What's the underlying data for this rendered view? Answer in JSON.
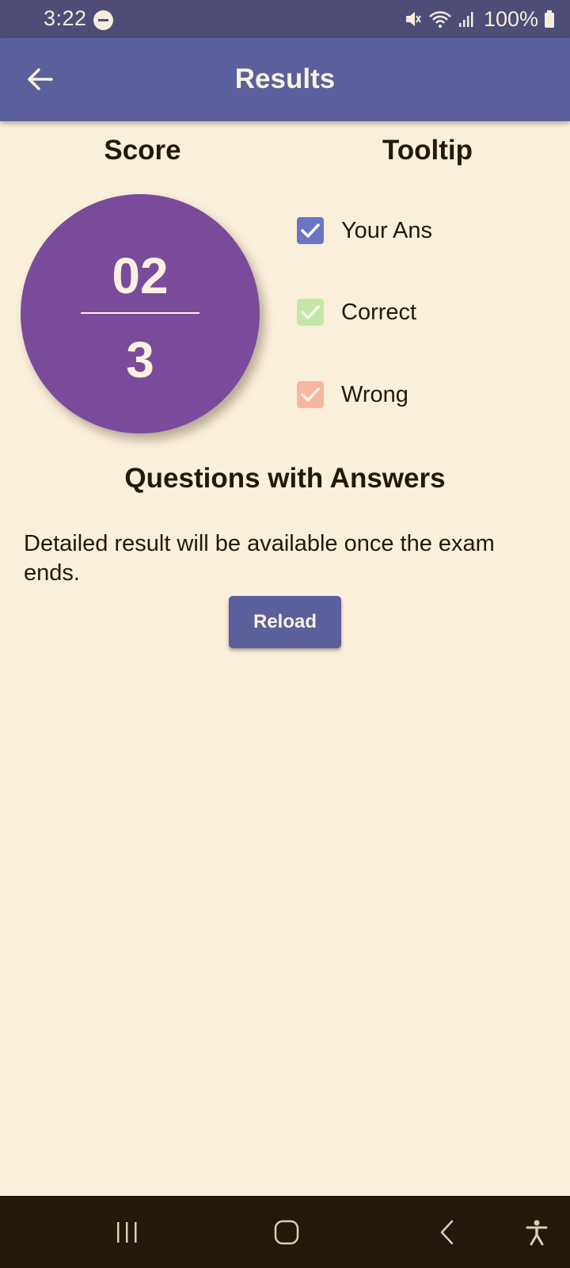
{
  "status_bar": {
    "time": "3:22",
    "battery": "100%",
    "icons": [
      "do-not-disturb-icon",
      "mute-icon",
      "wifi-icon",
      "signal-icon",
      "battery-icon"
    ]
  },
  "app_bar": {
    "title": "Results",
    "back_icon": "arrow-left-icon"
  },
  "score": {
    "heading": "Score",
    "obtained": "02",
    "total": "3"
  },
  "tooltip": {
    "heading": "Tooltip",
    "items": [
      {
        "label": "Your Ans",
        "color": "#6a76c2"
      },
      {
        "label": "Correct",
        "color": "#c3e8a6"
      },
      {
        "label": "Wrong",
        "color": "#f7b6a0"
      }
    ]
  },
  "questions": {
    "heading": "Questions with Answers",
    "message": "Detailed result will be available once the exam ends.",
    "reload_label": "Reload"
  },
  "nav_bar": {
    "icons": [
      "recents-icon",
      "home-icon",
      "back-icon",
      "accessibility-icon"
    ]
  },
  "colors": {
    "background": "#faefdb",
    "app_bar": "#5b5f9c",
    "status_bar": "#4d4d78",
    "score_circle": "#7a4b9b",
    "nav_bar": "#231809"
  }
}
